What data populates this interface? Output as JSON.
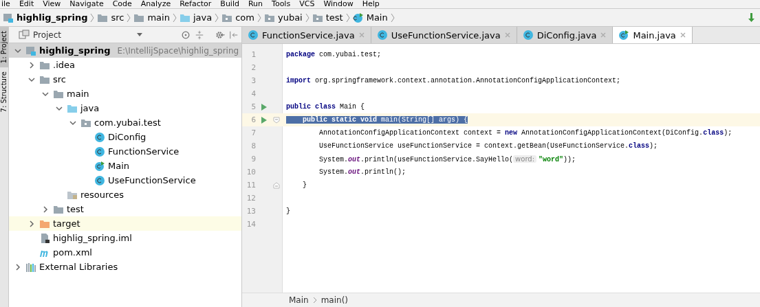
{
  "menu_bar": [
    "ile",
    "Edit",
    "View",
    "Navigate",
    "Code",
    "Analyze",
    "Refactor",
    "Build",
    "Run",
    "Tools",
    "VCS",
    "Window",
    "Help"
  ],
  "breadcrumbs": [
    {
      "label": "highlig_spring",
      "kind": "module"
    },
    {
      "label": "src",
      "kind": "folder"
    },
    {
      "label": "main",
      "kind": "folder"
    },
    {
      "label": "java",
      "kind": "source"
    },
    {
      "label": "com",
      "kind": "package"
    },
    {
      "label": "yubai",
      "kind": "package"
    },
    {
      "label": "test",
      "kind": "package"
    },
    {
      "label": "Main",
      "kind": "main"
    }
  ],
  "tool_strip": [
    {
      "label": "1: Project",
      "selected": true
    },
    {
      "label": "7: Structure",
      "selected": false
    }
  ],
  "project_panel": {
    "title": "Project",
    "tree": [
      {
        "label": "highlig_spring",
        "path": "E:\\IntellijSpace\\highlig_spring",
        "kind": "module",
        "expanded": true,
        "selected": true,
        "highlighted": false,
        "children": [
          {
            "label": ".idea",
            "kind": "folder",
            "expanded": false,
            "selected": false,
            "highlighted": false
          },
          {
            "label": "src",
            "kind": "folder",
            "expanded": true,
            "selected": false,
            "highlighted": false,
            "children": [
              {
                "label": "main",
                "kind": "folder",
                "expanded": true,
                "selected": false,
                "highlighted": false,
                "children": [
                  {
                    "label": "java",
                    "kind": "source",
                    "expanded": true,
                    "selected": false,
                    "highlighted": false,
                    "children": [
                      {
                        "label": "com.yubai.test",
                        "kind": "package",
                        "expanded": true,
                        "selected": false,
                        "highlighted": false,
                        "children": [
                          {
                            "label": "DiConfig",
                            "kind": "class",
                            "selected": false,
                            "highlighted": false
                          },
                          {
                            "label": "FunctionService",
                            "kind": "class",
                            "selected": false,
                            "highlighted": false
                          },
                          {
                            "label": "Main",
                            "kind": "main",
                            "selected": false,
                            "highlighted": false
                          },
                          {
                            "label": "UseFunctionService",
                            "kind": "class",
                            "selected": false,
                            "highlighted": false
                          }
                        ]
                      }
                    ]
                  },
                  {
                    "label": "resources",
                    "kind": "resources",
                    "selected": false,
                    "highlighted": false
                  }
                ]
              },
              {
                "label": "test",
                "kind": "folder",
                "expanded": false,
                "selected": false,
                "highlighted": false
              }
            ]
          },
          {
            "label": "target",
            "kind": "excluded",
            "expanded": false,
            "selected": false,
            "highlighted": true
          },
          {
            "label": "highlig_spring.iml",
            "kind": "iml",
            "selected": false,
            "highlighted": false
          },
          {
            "label": "pom.xml",
            "kind": "maven",
            "selected": false,
            "highlighted": false
          }
        ]
      },
      {
        "label": "External Libraries",
        "kind": "libraries",
        "expanded": false,
        "selected": false,
        "highlighted": false
      }
    ]
  },
  "tabs": [
    {
      "label": "FunctionService.java",
      "kind": "class",
      "selected": false
    },
    {
      "label": "UseFunctionService.java",
      "kind": "class",
      "selected": false
    },
    {
      "label": "DiConfig.java",
      "kind": "class",
      "selected": false
    },
    {
      "label": "Main.java",
      "kind": "main",
      "selected": true
    }
  ],
  "editor": {
    "lines": [
      {
        "number": "1",
        "run": false,
        "fold_open": false,
        "fold_close": false,
        "selected": false,
        "segments": [
          {
            "kind": "keyword",
            "text": "package"
          },
          {
            "kind": "plain",
            "text": " com.yubai.test;"
          }
        ]
      },
      {
        "number": "2",
        "run": false,
        "fold_open": false,
        "fold_close": false,
        "selected": false
      },
      {
        "number": "3",
        "run": false,
        "fold_open": false,
        "fold_close": false,
        "selected": false,
        "segments": [
          {
            "kind": "keyword",
            "text": "import"
          },
          {
            "kind": "plain",
            "text": " org.springframework.context.annotation.AnnotationConfigApplicationContext;"
          }
        ]
      },
      {
        "number": "4",
        "run": false,
        "fold_open": false,
        "fold_close": false,
        "selected": false
      },
      {
        "number": "5",
        "run": true,
        "fold_open": false,
        "fold_close": false,
        "selected": false,
        "segments": [
          {
            "kind": "keyword",
            "text": "public class"
          },
          {
            "kind": "plain",
            "text": " Main {"
          }
        ]
      },
      {
        "number": "6",
        "run": true,
        "fold_open": true,
        "fold_close": false,
        "selected": true,
        "segments": [
          {
            "kind": "keyword",
            "text": "    public static void"
          },
          {
            "kind": "plain",
            "text": " main(String[] args) {"
          }
        ]
      },
      {
        "number": "7",
        "run": false,
        "fold_open": false,
        "fold_close": false,
        "selected": false,
        "segments": [
          {
            "kind": "plain",
            "text": "        AnnotationConfigApplicationContext context = "
          },
          {
            "kind": "keyword",
            "text": "new"
          },
          {
            "kind": "plain",
            "text": " AnnotationConfigApplicationContext(DiConfig."
          },
          {
            "kind": "keyword",
            "text": "class"
          },
          {
            "kind": "plain",
            "text": ");"
          }
        ]
      },
      {
        "number": "8",
        "run": false,
        "fold_open": false,
        "fold_close": false,
        "selected": false,
        "segments": [
          {
            "kind": "plain",
            "text": "        UseFunctionService useFunctionService = context.getBean(UseFunctionService."
          },
          {
            "kind": "keyword",
            "text": "class"
          },
          {
            "kind": "plain",
            "text": ");"
          }
        ]
      },
      {
        "number": "9",
        "run": false,
        "fold_open": false,
        "fold_close": false,
        "selected": false,
        "segments": [
          {
            "kind": "plain",
            "text": "        System."
          },
          {
            "kind": "static",
            "text": "out"
          },
          {
            "kind": "plain",
            "text": ".println(useFunctionService.SayHello("
          },
          {
            "kind": "hint",
            "text": "word:"
          },
          {
            "kind": "string",
            "text": "\"word\""
          },
          {
            "kind": "plain",
            "text": "));"
          }
        ]
      },
      {
        "number": "10",
        "run": false,
        "fold_open": false,
        "fold_close": false,
        "selected": false,
        "segments": [
          {
            "kind": "plain",
            "text": "        System."
          },
          {
            "kind": "static",
            "text": "out"
          },
          {
            "kind": "plain",
            "text": ".println();"
          }
        ]
      },
      {
        "number": "11",
        "run": false,
        "fold_open": false,
        "fold_close": true,
        "selected": false,
        "segments": [
          {
            "kind": "plain",
            "text": "    }"
          }
        ]
      },
      {
        "number": "12",
        "run": false,
        "fold_open": false,
        "fold_close": false,
        "selected": false
      },
      {
        "number": "13",
        "run": false,
        "fold_open": false,
        "fold_close": false,
        "selected": false,
        "segments": [
          {
            "kind": "plain",
            "text": "}"
          }
        ]
      },
      {
        "number": "14",
        "run": false,
        "fold_open": false,
        "fold_close": false,
        "selected": false
      }
    ]
  },
  "editor_breadcrumbs": [
    "Main",
    "main()"
  ]
}
